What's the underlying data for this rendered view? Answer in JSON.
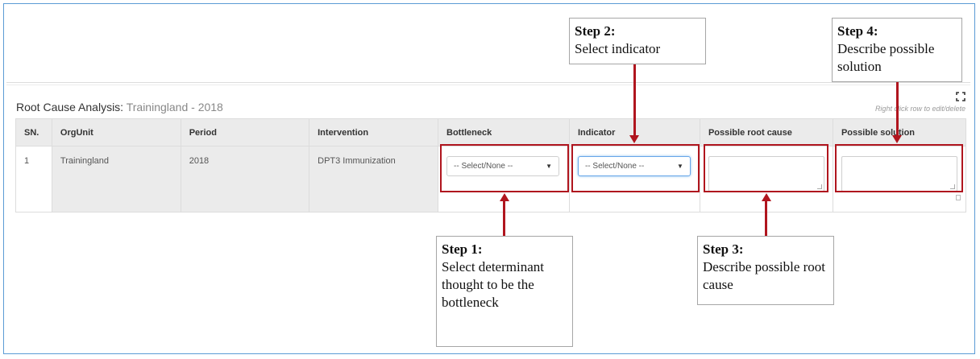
{
  "panel": {
    "title": "Root Cause Analysis:",
    "subtitle": "Trainingland - 2018",
    "hint": "Right click row to edit/delete"
  },
  "table": {
    "headers": [
      "SN.",
      "OrgUnit",
      "Period",
      "Intervention",
      "Bottleneck",
      "Indicator",
      "Possible root cause",
      "Possible solution"
    ],
    "row": {
      "sn": "1",
      "orgunit": "Trainingland",
      "period": "2018",
      "intervention": "DPT3 Immunization",
      "bottleneck_value": "-- Select/None --",
      "indicator_value": "-- Select/None --",
      "root_cause_value": "",
      "solution_value": ""
    }
  },
  "callouts": {
    "step1": {
      "step": "Step 1:",
      "desc": "Select determinant thought to be the bottleneck"
    },
    "step2": {
      "step": "Step 2:",
      "desc": "Select indicator"
    },
    "step3": {
      "step": "Step 3:",
      "desc": "Describe possible root cause"
    },
    "step4": {
      "step": "Step 4:",
      "desc": "Describe possible solution"
    }
  },
  "colors": {
    "annotation_red": "#b0151e",
    "frame_blue": "#5b9bd5",
    "header_gray": "#ebebeb"
  },
  "icons": [
    "expand-icon",
    "dropdown-arrow-icon",
    "resize-grip-icon",
    "delete-icon"
  ]
}
